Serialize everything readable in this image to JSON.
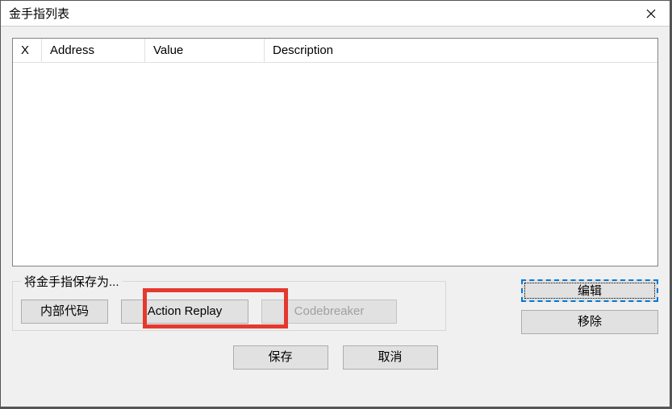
{
  "window": {
    "title": "金手指列表"
  },
  "list": {
    "columns": {
      "x": "X",
      "address": "Address",
      "value": "Value",
      "description": "Description"
    }
  },
  "saveGroup": {
    "legend": "将金手指保存为...",
    "buttons": {
      "internal": "内部代码",
      "actionReplay": "Action Replay",
      "codebreaker": "Codebreaker"
    }
  },
  "sideButtons": {
    "edit": "编辑",
    "remove": "移除"
  },
  "bottomButtons": {
    "save": "保存",
    "cancel": "取消"
  }
}
